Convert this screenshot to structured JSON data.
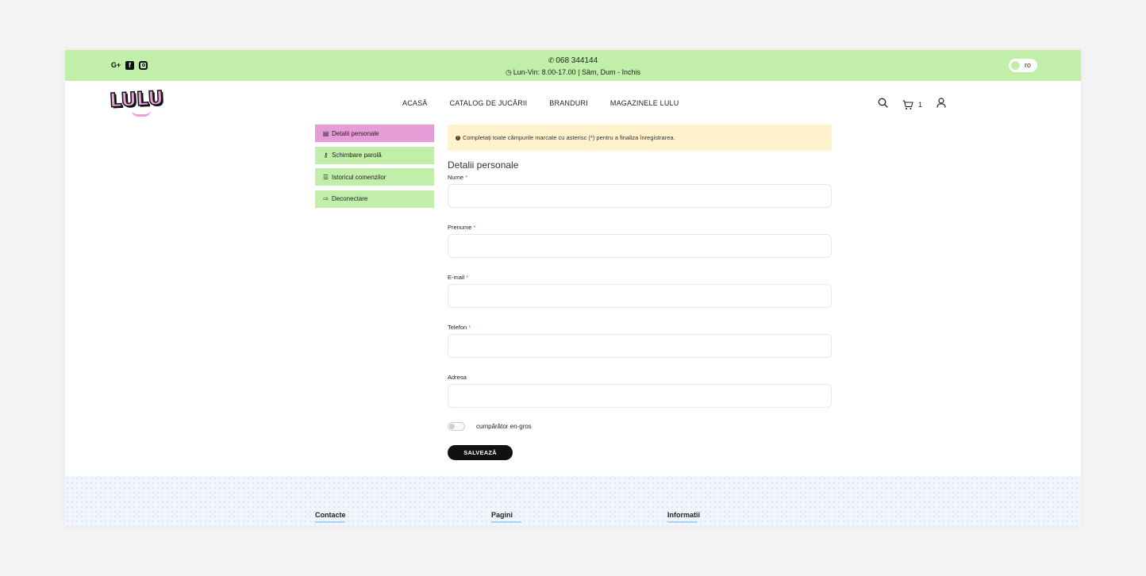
{
  "topbar": {
    "phone": "068 344144",
    "hours": "Lun-Vin: 8.00-17.00 | Sâm, Dum - închis",
    "lang": "ro",
    "social_icons": [
      "google-plus-icon",
      "facebook-icon",
      "instagram-icon"
    ],
    "bg_color": "#c1eea9"
  },
  "header": {
    "logo_text": "LULU",
    "nav": [
      "ACASĂ",
      "CATALOG DE JUCĂRII",
      "BRANDURI",
      "MAGAZINELE LULU"
    ],
    "cart_count": "1"
  },
  "sidebar": {
    "items": [
      {
        "label": "Detalii personale",
        "icon": "id-card-icon",
        "active": true
      },
      {
        "label": "Schimbare parolă",
        "icon": "key-icon",
        "active": false
      },
      {
        "label": "Istoricul comenzilor",
        "icon": "list-icon",
        "active": false
      },
      {
        "label": "Deconectare",
        "icon": "sign-out-icon",
        "active": false
      }
    ],
    "active_color": "#e69cd7"
  },
  "main": {
    "alert": "Completați toate câmpurile marcate cu asterisc (*) pentru a finaliza înregistrarea.",
    "section_title": "Detalii personale",
    "fields": [
      {
        "label": "Nume",
        "required": "*",
        "value": ""
      },
      {
        "label": "Prenume",
        "required": "*",
        "value": ""
      },
      {
        "label": "E-mail",
        "required": "*",
        "value": ""
      },
      {
        "label": "Telefon",
        "required": "*",
        "value": ""
      },
      {
        "label": "Adresa",
        "required": "",
        "value": ""
      }
    ],
    "wholesale_label": "cumpărător en-gros",
    "save_label": "SALVEAZĂ"
  },
  "footer": {
    "columns": [
      "Contacte",
      "Pagini",
      "Informatii"
    ]
  }
}
